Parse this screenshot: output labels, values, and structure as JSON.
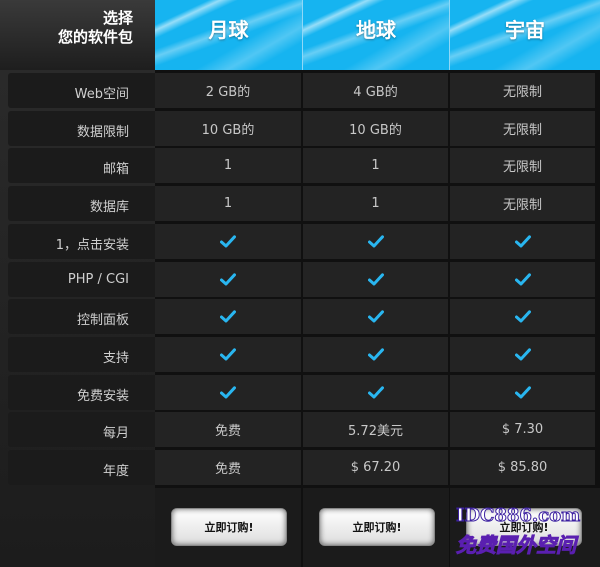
{
  "header": {
    "choose_line1": "选择",
    "choose_line2": "您的软件包",
    "plans": [
      "月球",
      "地球",
      "宇宙"
    ]
  },
  "rows": [
    {
      "label": "Web空间",
      "values": [
        "2 GB的",
        "4 GB的",
        "无限制"
      ]
    },
    {
      "label": "数据限制",
      "values": [
        "10 GB的",
        "10 GB的",
        "无限制"
      ]
    },
    {
      "label": "邮箱",
      "values": [
        "1",
        "1",
        "无限制"
      ]
    },
    {
      "label": "数据库",
      "values": [
        "1",
        "1",
        "无限制"
      ]
    },
    {
      "label": "1，点击安装",
      "values": [
        "check",
        "check",
        "check"
      ]
    },
    {
      "label": "PHP / CGI",
      "values": [
        "check",
        "check",
        "check"
      ]
    },
    {
      "label": "控制面板",
      "values": [
        "check",
        "check",
        "check"
      ]
    },
    {
      "label": "支持",
      "values": [
        "check",
        "check",
        "check"
      ]
    },
    {
      "label": "免费安装",
      "values": [
        "check",
        "check",
        "check"
      ]
    },
    {
      "label": "每月",
      "values": [
        "免费",
        "5.72美元",
        "$ 7.30"
      ]
    },
    {
      "label": "年度",
      "values": [
        "免费",
        "$ 67.20",
        "$ 85.80"
      ]
    }
  ],
  "buy": {
    "labels": [
      "立即订购!",
      "立即订购!",
      "立即订购!"
    ]
  },
  "watermark": {
    "line1": "IDC886.com",
    "line2": "免费国外空间"
  },
  "colors": {
    "header_blue": "#16b4f0",
    "check": "#29b6f0"
  },
  "icons": {
    "check": "check-icon"
  }
}
